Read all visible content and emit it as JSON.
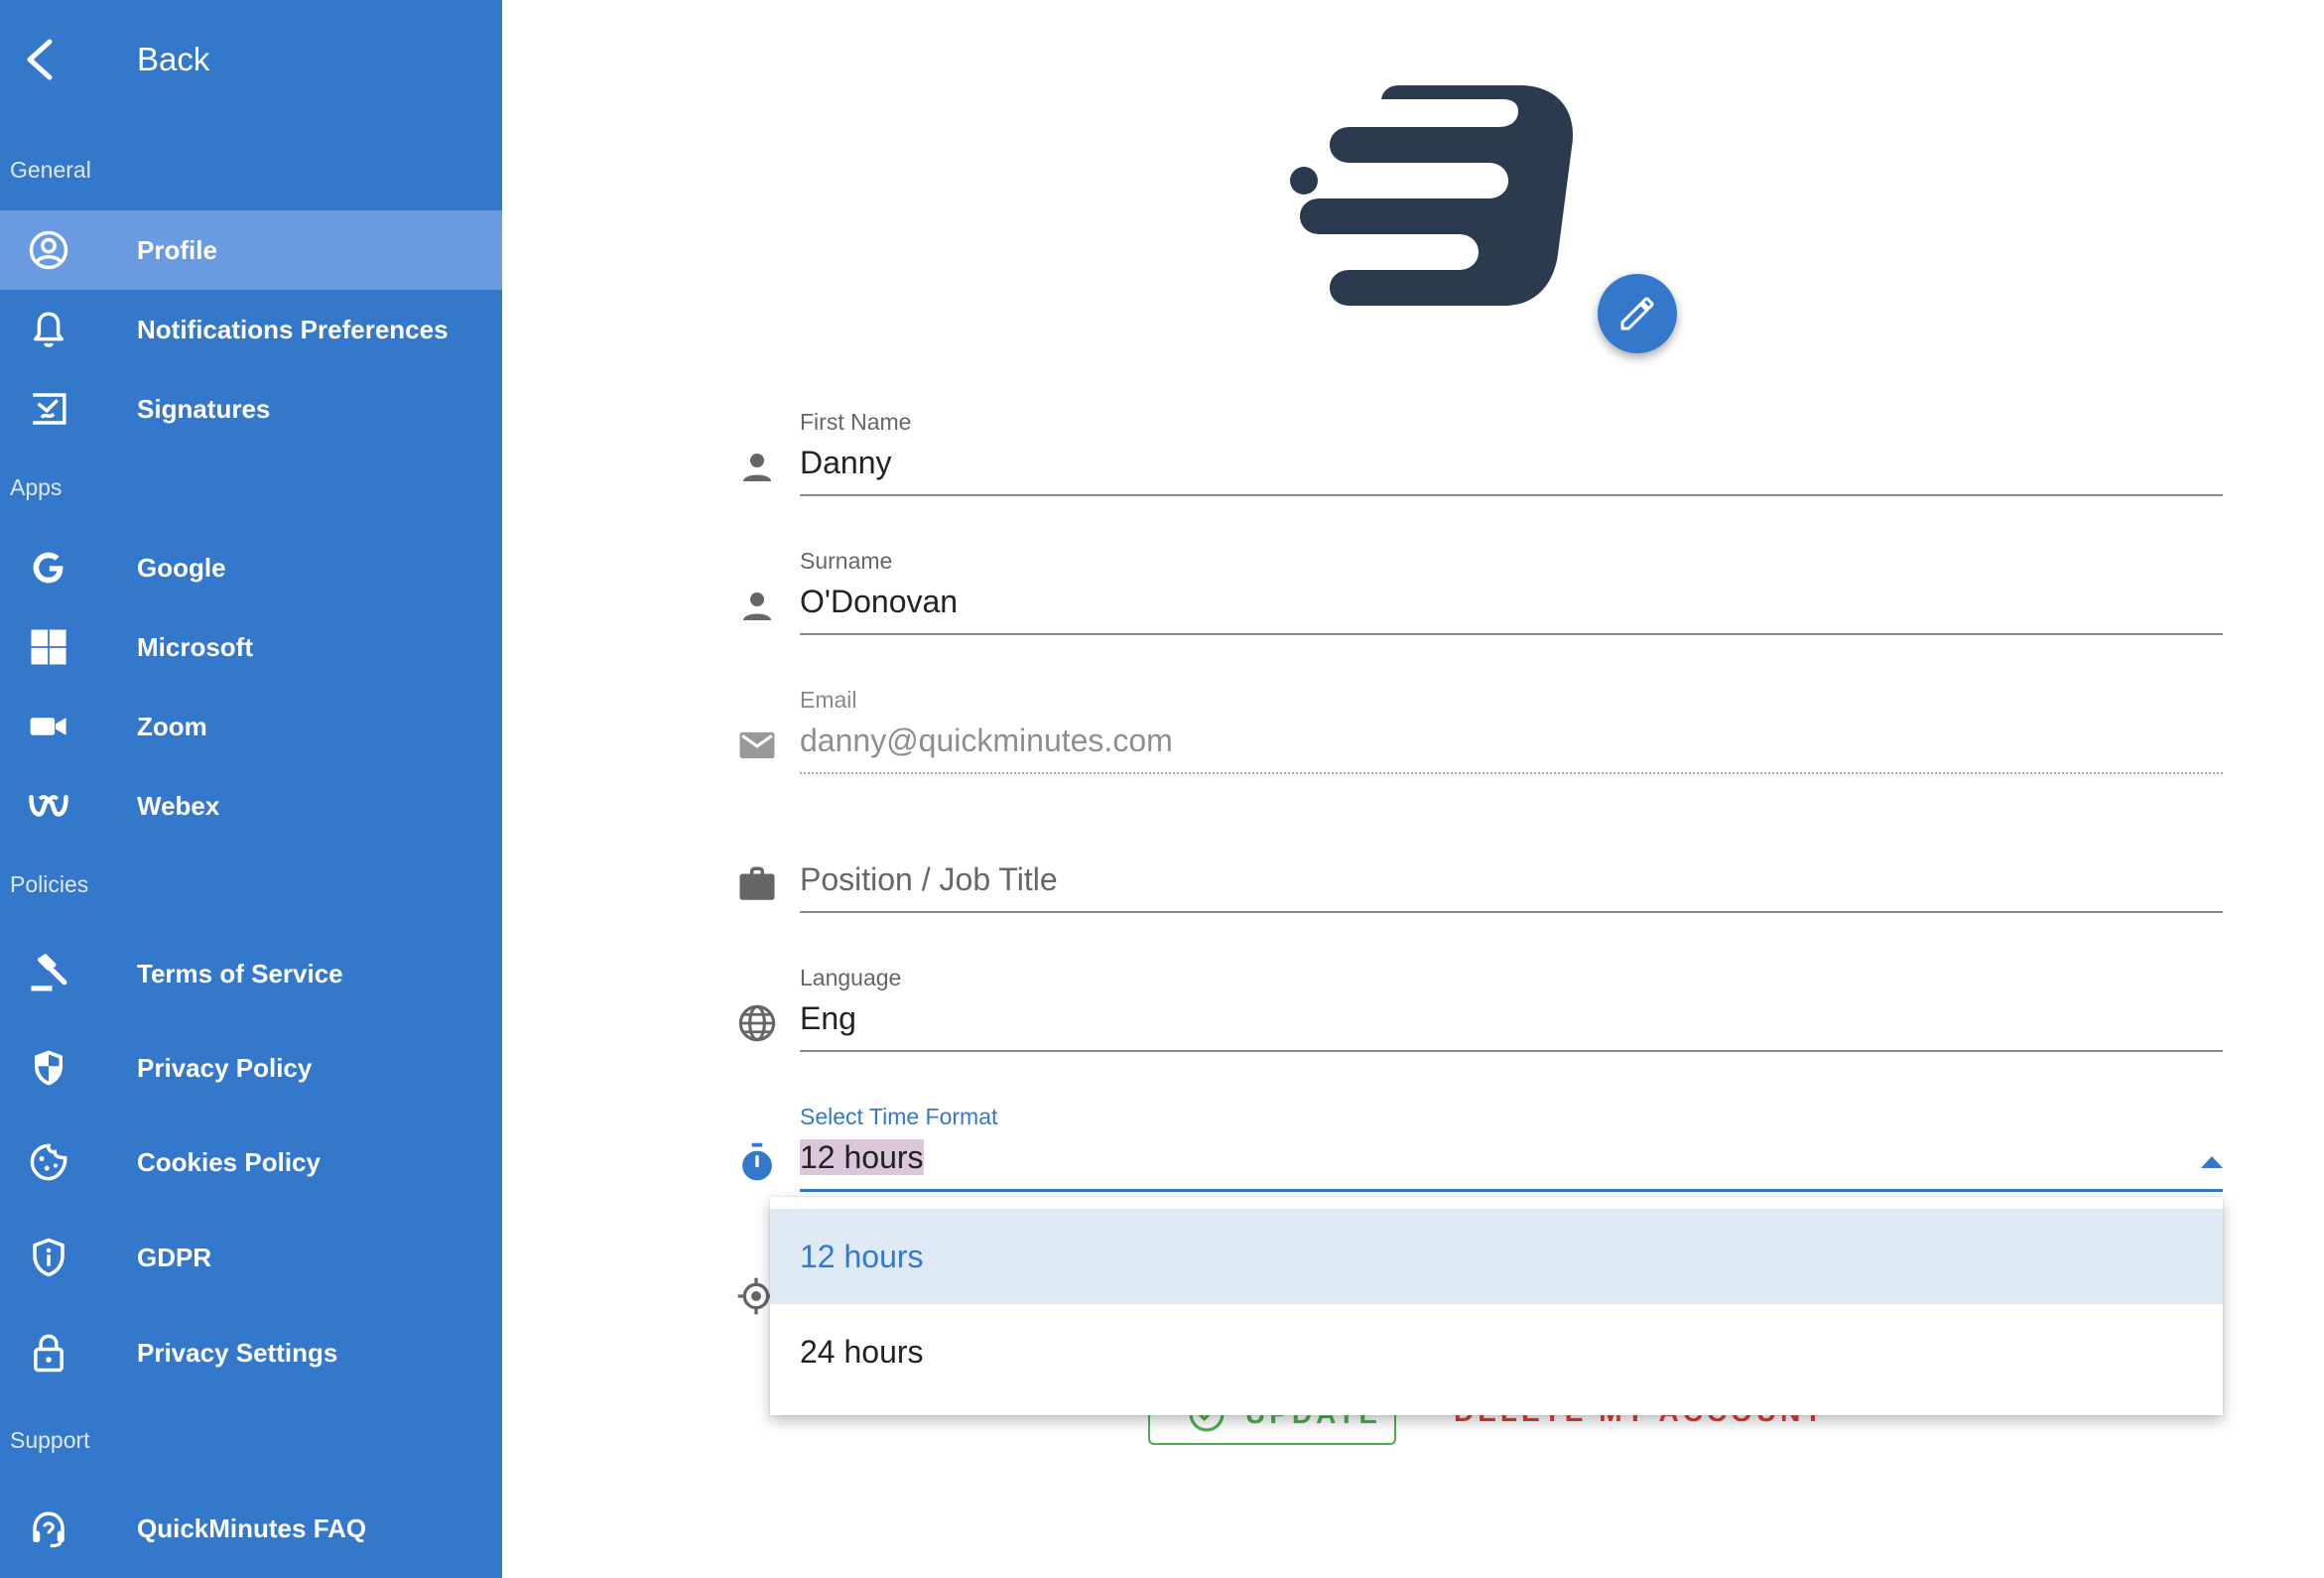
{
  "sidebar": {
    "back_label": "Back",
    "sections": {
      "general": "General",
      "apps": "Apps",
      "policies": "Policies",
      "support": "Support"
    },
    "items": [
      {
        "label": "Profile",
        "icon": "account-circle-icon"
      },
      {
        "label": "Notifications Preferences",
        "icon": "bell-icon"
      },
      {
        "label": "Signatures",
        "icon": "signature-icon"
      },
      {
        "label": "Google",
        "icon": "google-icon"
      },
      {
        "label": "Microsoft",
        "icon": "microsoft-icon"
      },
      {
        "label": "Zoom",
        "icon": "video-camera-icon"
      },
      {
        "label": "Webex",
        "icon": "webex-icon"
      },
      {
        "label": "Terms of Service",
        "icon": "gavel-icon"
      },
      {
        "label": "Privacy Policy",
        "icon": "shield-icon"
      },
      {
        "label": "Cookies Policy",
        "icon": "cookie-icon"
      },
      {
        "label": "GDPR",
        "icon": "shield-info-icon"
      },
      {
        "label": "Privacy Settings",
        "icon": "lock-icon"
      },
      {
        "label": "QuickMinutes FAQ",
        "icon": "headset-icon"
      }
    ],
    "active_item": "Profile"
  },
  "profile": {
    "first_name": {
      "label": "First Name",
      "value": "Danny"
    },
    "surname": {
      "label": "Surname",
      "value": "O'Donovan"
    },
    "email": {
      "label": "Email",
      "value": "danny@quickminutes.com"
    },
    "position": {
      "placeholder": "Position / Job Title"
    },
    "language": {
      "label": "Language",
      "value": "Eng"
    },
    "time_format": {
      "label": "Select Time Format",
      "value": "12 hours",
      "options": [
        "12 hours",
        "24 hours"
      ]
    }
  },
  "actions": {
    "update_label": "UPDATE",
    "delete_label": "DELETE MY ACCOUNT"
  },
  "colors": {
    "sidebar_bg": "#3478cc",
    "sidebar_active": "#6a9be0",
    "accent": "#3478cc",
    "update": "#4caf50",
    "delete": "#e53935"
  }
}
